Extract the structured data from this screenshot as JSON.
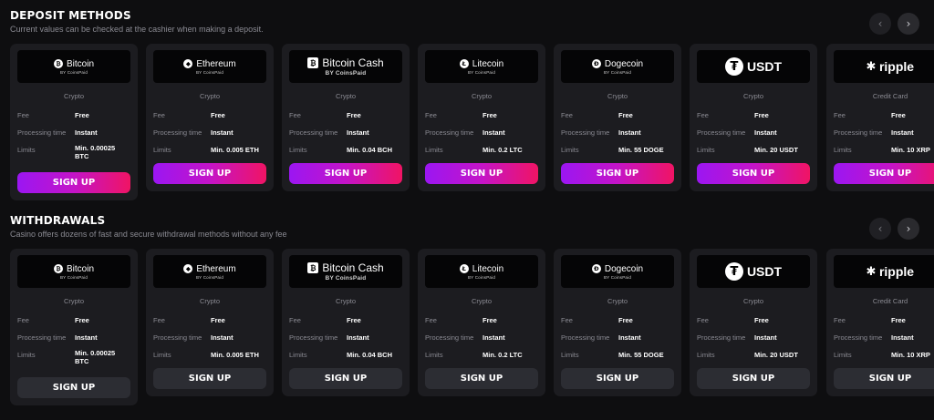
{
  "sections": [
    {
      "title": "DEPOSIT METHODS",
      "subtitle": "Current values can be checked at the cashier when making a deposit.",
      "prev_icon": "chevron-left-icon",
      "next_icon": "chevron-right-icon",
      "button_style": "gradient"
    },
    {
      "title": "WITHDRAWALS",
      "subtitle": "Casino offers dozens of fast and secure withdrawal methods without any fee",
      "prev_icon": "chevron-left-icon",
      "next_icon": "chevron-right-icon",
      "button_style": "dark"
    }
  ],
  "labels": {
    "fee": "Fee",
    "processing": "Processing time",
    "limits": "Limits",
    "signup": "SIGN UP",
    "byline": "BY CoinsPaid"
  },
  "methods": [
    {
      "name": "Bitcoin",
      "icon": "bitcoin-icon",
      "category": "Crypto",
      "fee": "Free",
      "processing": "Instant",
      "limits": "Min. 0.00025 BTC",
      "byline": true
    },
    {
      "name": "Ethereum",
      "icon": "ethereum-icon",
      "category": "Crypto",
      "fee": "Free",
      "processing": "Instant",
      "limits": "Min. 0.005 ETH",
      "byline": true
    },
    {
      "name": "Bitcoin Cash",
      "icon": "bitcoin-cash-icon",
      "category": "Crypto",
      "fee": "Free",
      "processing": "Instant",
      "limits": "Min. 0.04 BCH",
      "byline": true
    },
    {
      "name": "Litecoin",
      "icon": "litecoin-icon",
      "category": "Crypto",
      "fee": "Free",
      "processing": "Instant",
      "limits": "Min. 0.2 LTC",
      "byline": true
    },
    {
      "name": "Dogecoin",
      "icon": "dogecoin-icon",
      "category": "Crypto",
      "fee": "Free",
      "processing": "Instant",
      "limits": "Min. 55 DOGE",
      "byline": true
    },
    {
      "name": "USDT",
      "icon": "tether-icon",
      "category": "Crypto",
      "fee": "Free",
      "processing": "Instant",
      "limits": "Min. 20 USDT",
      "byline": false
    },
    {
      "name": "ripple",
      "icon": "ripple-icon",
      "category": "Credit Card",
      "fee": "Free",
      "processing": "Instant",
      "limits": "Min. 10 XRP",
      "byline": false
    }
  ],
  "colors": {
    "gradient_start": "#9b16f2",
    "gradient_end": "#f01464",
    "card_bg": "#1c1c20",
    "page_bg": "#0e0e10"
  }
}
